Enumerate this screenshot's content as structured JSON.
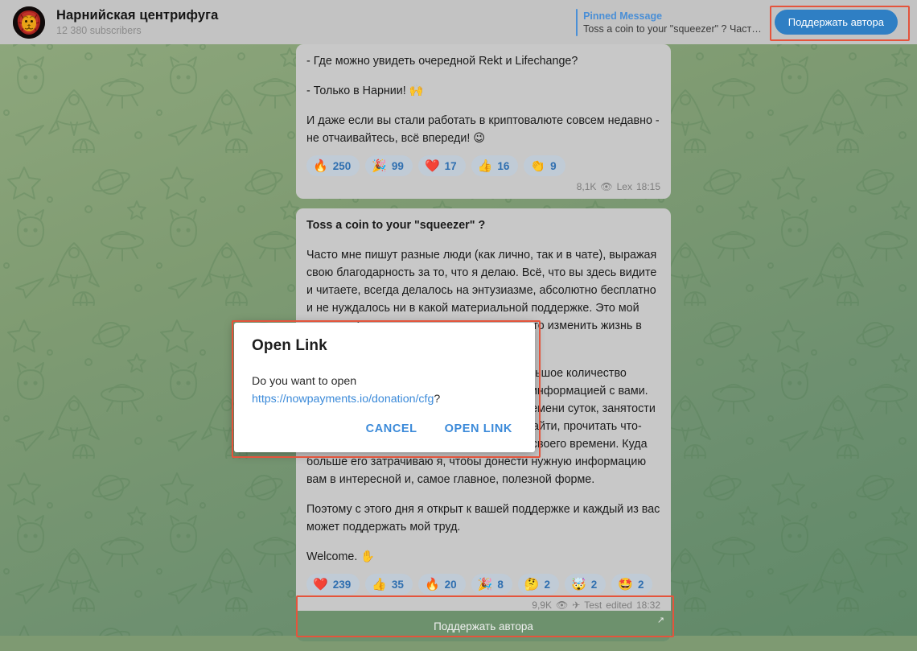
{
  "header": {
    "channel_title": "Нарнийская центрифуга",
    "subscribers": "12 380 subscribers",
    "avatar_icon": "lion-avatar",
    "pinned": {
      "label": "Pinned Message",
      "preview": "Toss a coin to your \"squeezer\" ? Част…"
    },
    "support_button": "Поддержать автора"
  },
  "messages": [
    {
      "paragraphs": [
        "- Где можно увидеть очередной Rekt и Lifechange?",
        "- Только в Нарнии! 🙌",
        "И даже если вы стали работать в криптовалюте совсем недавно - не отчаивайтесь, всё впереди! 😉"
      ],
      "reactions": [
        {
          "icon": "🔥",
          "name": "fire-reaction",
          "count": "250"
        },
        {
          "icon": "🎉",
          "name": "party-popper-reaction",
          "count": "99"
        },
        {
          "icon": "❤️",
          "name": "heart-reaction",
          "count": "17"
        },
        {
          "icon": "👍",
          "name": "thumbs-up-reaction",
          "count": "16"
        },
        {
          "icon": "👏",
          "name": "clap-reaction",
          "count": "9"
        }
      ],
      "views": "8,1K",
      "eye_icon": "👁",
      "author": "Lex",
      "time": "18:15"
    },
    {
      "title": "Toss a coin to your \"squeezer\" ?",
      "paragraphs": [
        "Часто мне пишут разные люди (как лично, так и в чате), выражая свою благодарность за то, что я делаю. Всё, что вы здесь видите и читаете, всегда делалось на энтузиазме, абсолютно бесплатно и не нуждалось ни в какой материальной поддержке. Это мой вклад в общее дело и попытка хоть немного изменить жизнь в лучшую сторону.",
        "Но время идёт, а я стараюсь доносить большое количество разной, полезной и главное проверенной информацией с вами. Вне зависимости от моего настроения, времени суток, занятости или самочувствия. Каждый из вас может зайти, прочитать что-либо и применить это, затратив минимум своего времени. Куда больше его затрачиваю я, чтобы донести нужную информацию вам в интересной и, самое главное, полезной форме.",
        "Поэтому с этого дня я открыт к вашей поддержке и каждый из вас может поддержать мой труд.",
        "Welcome. ✋"
      ],
      "reactions": [
        {
          "icon": "❤️",
          "name": "heart-reaction",
          "count": "239"
        },
        {
          "icon": "👍",
          "name": "thumbs-up-reaction",
          "count": "35"
        },
        {
          "icon": "🔥",
          "name": "fire-reaction",
          "count": "20"
        },
        {
          "icon": "🎉",
          "name": "party-popper-reaction",
          "count": "8"
        },
        {
          "icon": "🤔",
          "name": "thinking-reaction",
          "count": "2"
        },
        {
          "icon": "🤯",
          "name": "mind-blown-reaction",
          "count": "2"
        },
        {
          "icon": "🤩",
          "name": "star-struck-reaction",
          "count": "2"
        }
      ],
      "views": "9,9K",
      "eye_icon": "👁",
      "forward_icon": "✈",
      "author": "Test",
      "edited": "edited",
      "time": "18:32",
      "inline_button": "Поддержать автора",
      "inline_button_arrow": "↗"
    }
  ],
  "dialog": {
    "title": "Open Link",
    "question": "Do you want to open",
    "url": "https://nowpayments.io/donation/cfg",
    "question_suffix": "?",
    "cancel": "CANCEL",
    "confirm": "OPEN LINK"
  },
  "colors": {
    "accent_blue": "#2f7fc4",
    "link_blue": "#3b8ad9",
    "annotation_red": "#e4543c",
    "header_grey": "#c3c3c3",
    "bubble_grey": "#c8c8c8"
  }
}
